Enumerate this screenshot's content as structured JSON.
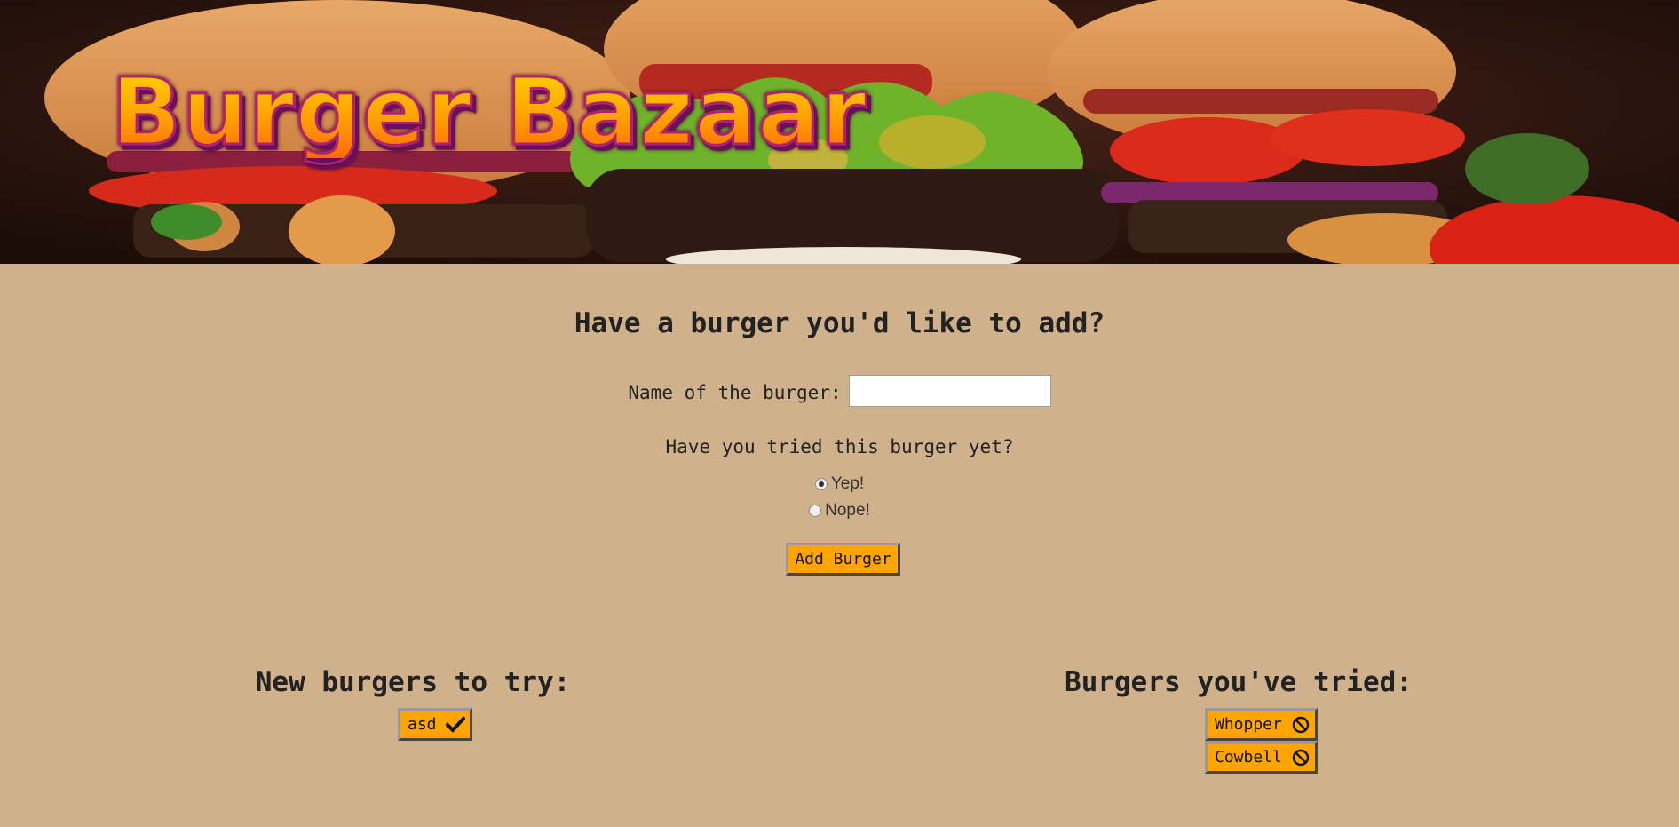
{
  "header": {
    "brand_title": "Burger Bazaar",
    "hero_image": "burgers-photo"
  },
  "form": {
    "heading": "Have a burger you'd like to add?",
    "name_label": "Name of the burger:",
    "name_value": "",
    "tried_question": "Have you tried this burger yet?",
    "options": [
      {
        "label": "Yep!",
        "checked": true
      },
      {
        "label": "Nope!",
        "checked": false
      }
    ],
    "submit_label": "Add Burger"
  },
  "new_burgers": {
    "heading": "New burgers to try:",
    "items": [
      {
        "name": "asd",
        "icon": "checkmark-icon"
      }
    ]
  },
  "tried_burgers": {
    "heading": "Burgers you've tried:",
    "items": [
      {
        "name": "Whopper",
        "icon": "ban-icon"
      },
      {
        "name": "Cowbell",
        "icon": "ban-icon"
      }
    ]
  },
  "colors": {
    "background": "#cfb18c",
    "button": "#ffa500",
    "title_fill": "#ffb300",
    "title_outline": "#b0216f"
  }
}
